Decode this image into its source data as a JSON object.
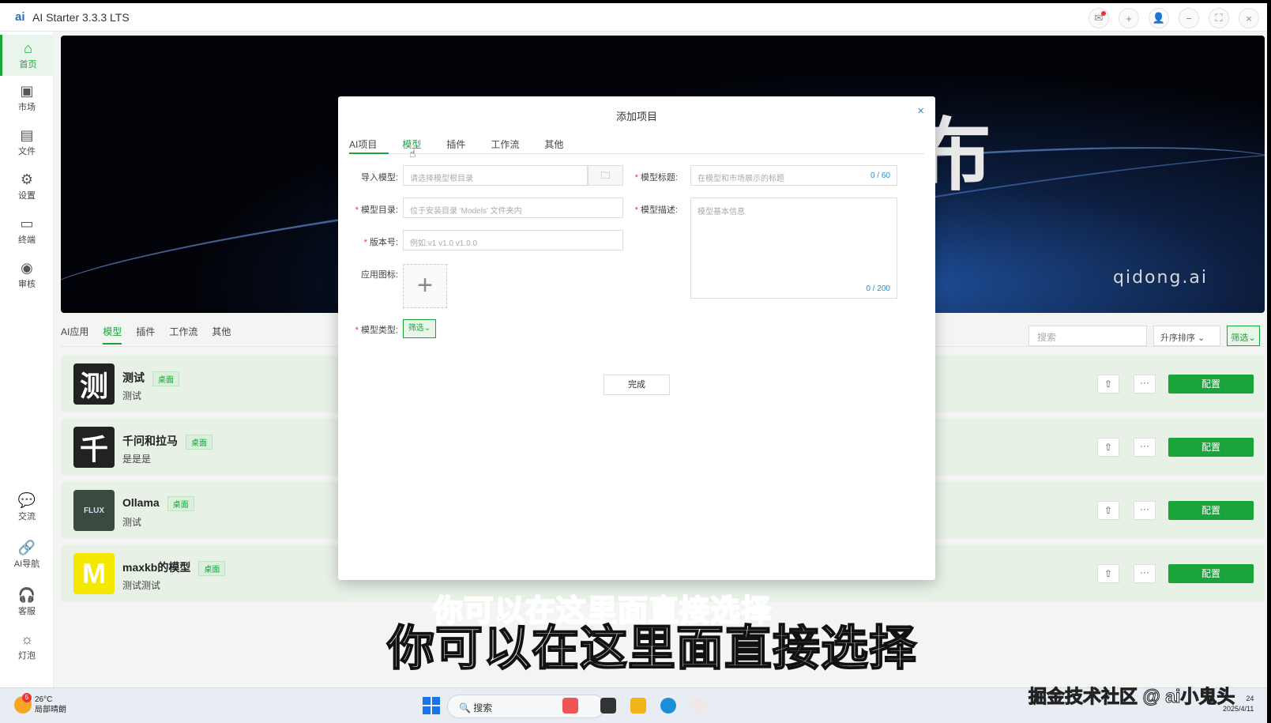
{
  "app": {
    "title": "AI Starter 3.3.3 LTS",
    "logo": "ai"
  },
  "window_buttons": [
    {
      "icon": "mail-icon",
      "glyph": "✉"
    },
    {
      "icon": "plus-icon",
      "glyph": "+"
    },
    {
      "icon": "user-icon",
      "glyph": "👤"
    },
    {
      "icon": "minimize-icon",
      "glyph": "−"
    },
    {
      "icon": "maximize-icon",
      "glyph": "⛶"
    },
    {
      "icon": "close-icon",
      "glyph": "×"
    }
  ],
  "sidebar": {
    "items": [
      {
        "label": "首页",
        "icon": "home-icon",
        "glyph": "⌂"
      },
      {
        "label": "市场",
        "icon": "store-icon",
        "glyph": "▣"
      },
      {
        "label": "文件",
        "icon": "file-icon",
        "glyph": "▤"
      },
      {
        "label": "设置",
        "icon": "gear-icon",
        "glyph": "⚙"
      },
      {
        "label": "终端",
        "icon": "terminal-icon",
        "glyph": "▭"
      },
      {
        "label": "审核",
        "icon": "eye-icon",
        "glyph": "◉"
      },
      {
        "label": "交流",
        "icon": "chat-icon",
        "glyph": "💬"
      },
      {
        "label": "AI导航",
        "icon": "link-icon",
        "glyph": "🔗"
      },
      {
        "label": "客服",
        "icon": "headset-icon",
        "glyph": "🎧"
      },
      {
        "label": "灯泡",
        "icon": "bulb-icon",
        "glyph": "☼"
      }
    ]
  },
  "banner": {
    "glyph": "布",
    "domain": "qidong.ai"
  },
  "category_tabs": [
    "AI应用",
    "模型",
    "插件",
    "工作流",
    "其他"
  ],
  "toolbar": {
    "search_placeholder": "搜索",
    "sort": "升序排序",
    "filter": "筛选"
  },
  "list": [
    {
      "avatar": "测",
      "name": "测试",
      "tag": "桌面",
      "desc": "测试",
      "color": "#222222"
    },
    {
      "avatar": "千",
      "name": "千问和拉马",
      "tag": "桌面",
      "desc": "是是是",
      "color": "#222222"
    },
    {
      "avatar": "FLUX",
      "name": "Ollama",
      "tag": "桌面",
      "desc": "测试",
      "color": "#3b4a3e"
    },
    {
      "avatar": "M",
      "name": "maxkb的模型",
      "tag": "桌面",
      "desc": "测试测试",
      "color": "#f5e800"
    }
  ],
  "list_actions": {
    "share": "⇧",
    "more": "···",
    "config": "配置"
  },
  "modal": {
    "title": "添加项目",
    "tabs": [
      "AI项目",
      "模型",
      "插件",
      "工作流",
      "其他"
    ],
    "import_label": "导入模型:",
    "import_placeholder": "请选择模型根目录",
    "dir_label": "模型目录:",
    "dir_placeholder": "位于安装目录 'Models' 文件夹内",
    "version_label": "版本号:",
    "version_placeholder": "例如:v1 v1.0 v1.0.0",
    "icon_label": "应用图标:",
    "type_label": "模型类型:",
    "type_button": "筛选",
    "title_label": "模型标题:",
    "title_placeholder": "在模型和市场展示的标题",
    "title_count": "0 / 60",
    "desc_label": "模型描述:",
    "desc_placeholder": "模型基本信息",
    "desc_count": "0 / 200",
    "done": "完成"
  },
  "subtitle": "你可以在这里面直接选择",
  "taskbar": {
    "weather_badge": "5",
    "weather_temp": "26°C",
    "weather_desc": "局部晴朗",
    "search": "搜索",
    "watermark": "掘金技术社区 @ ai小鬼头",
    "time": "24",
    "date": "2025/4/11"
  }
}
